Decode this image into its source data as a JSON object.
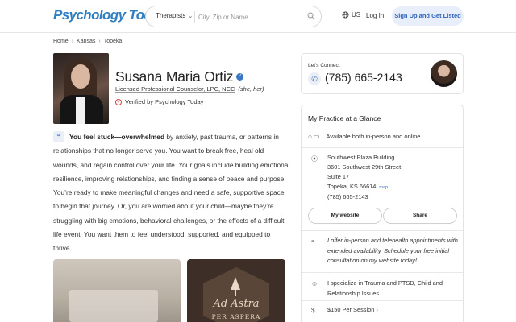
{
  "header": {
    "logo": "Psychology Today",
    "search_category": "Therapists",
    "search_placeholder": "City, Zip or Name",
    "language": "US",
    "login": "Log In",
    "signup": "Sign Up and Get Listed"
  },
  "breadcrumb": [
    "Home",
    "Kansas",
    "Topeka"
  ],
  "profile": {
    "name": "Susana Maria Ortiz",
    "credentials": "Licensed Professional Counselor, LPC, NCC",
    "pronouns": "(she, her)",
    "verified": "Verified by Psychology Today"
  },
  "bio": {
    "lead": "You feel stuck—overwhelmed",
    "text": " by anxiety, past trauma, or patterns in relationships that no longer serve you. You want to break free, heal old wounds, and regain control over your life. Your goals include building emotional resilience, improving relationships, and finding a sense of peace and purpose. You’re ready to make meaningful changes and need a safe, supportive space to begin that journey. Or, you are worried about your child—maybe they’re struggling with big emotions, behavioral challenges, or the effects of a difficult life event. You want them to feel understood, supported, and equipped to thrive."
  },
  "images": {
    "logo_line1": "Ad Astra",
    "logo_line2": "PER ASPERA"
  },
  "connect": {
    "label": "Let's Connect",
    "phone": "(785) 665-2143"
  },
  "practice": {
    "title": "My Practice at a Glance",
    "availability": "Available both in-person and online",
    "address_line1": "Southwest Plaza Building",
    "address_line2": "3601 Southwest 29th Street",
    "address_line3": "Suite 17",
    "address_line4": "Topeka, KS 66614",
    "map_link": "map",
    "address_phone": "(785) 665-2143",
    "website_btn": "My website",
    "share_btn": "Share",
    "quote": "I offer in-person and telehealth appointments with extended availability. Schedule your free initial consultation on my website today!",
    "specialty": "I specialize in Trauma and PTSD, Child and Relationship Issues",
    "fee": "$150 Per Session"
  },
  "colors": {
    "brand": "#2f7ec1",
    "accent_bg": "#e8eefa",
    "accent_text": "#2e62b8",
    "verified_red": "#d04545"
  }
}
